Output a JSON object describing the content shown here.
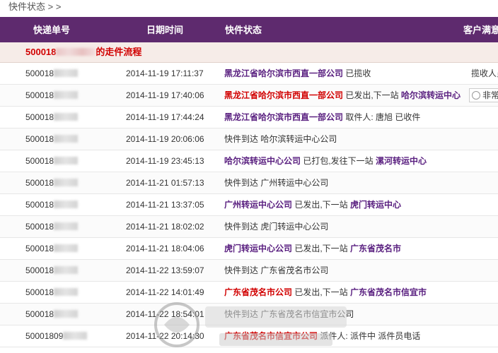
{
  "breadcrumb": "快件状态 > >",
  "columns": [
    "快递单号",
    "日期时间",
    "快件状态",
    "客户满意"
  ],
  "subheader": {
    "prefix": "500018",
    "suffix": "的走件流程"
  },
  "rows": [
    {
      "num": "500018",
      "time": "2014-11-19 17:11:37",
      "status": [
        {
          "t": "黑龙江省哈尔滨市西直一部公司",
          "s": "a1"
        },
        {
          "t": " 已揽收",
          "s": ""
        }
      ],
      "extra": "揽收人员"
    },
    {
      "num": "500018",
      "time": "2014-11-19 17:40:06",
      "status": [
        {
          "t": "黑龙江省哈尔滨市西直一部公司",
          "s": "a2"
        },
        {
          "t": " 已发出,下一站 ",
          "s": ""
        },
        {
          "t": "哈尔滨转运中心",
          "s": "a1"
        }
      ],
      "extra": "非常"
    },
    {
      "num": "500018",
      "time": "2014-11-19 17:44:24",
      "status": [
        {
          "t": "黑龙江省哈尔滨市西直一部公司",
          "s": "a1"
        },
        {
          "t": " 取件人: 唐旭 已收件",
          "s": ""
        }
      ],
      "extra": ""
    },
    {
      "num": "500018",
      "time": "2014-11-19 20:06:06",
      "status": [
        {
          "t": "快件到达 哈尔滨转运中心公司",
          "s": ""
        }
      ],
      "extra": ""
    },
    {
      "num": "500018",
      "time": "2014-11-19 23:45:13",
      "status": [
        {
          "t": "哈尔滨转运中心公司",
          "s": "a1"
        },
        {
          "t": " 已打包,发往下一站 ",
          "s": ""
        },
        {
          "t": "漯河转运中心",
          "s": "a1"
        }
      ],
      "extra": ""
    },
    {
      "num": "500018",
      "time": "2014-11-21 01:57:13",
      "status": [
        {
          "t": "快件到达 广州转运中心公司",
          "s": ""
        }
      ],
      "extra": ""
    },
    {
      "num": "500018",
      "time": "2014-11-21 13:37:05",
      "status": [
        {
          "t": "广州转运中心公司",
          "s": "a1"
        },
        {
          "t": " 已发出,下一站 ",
          "s": ""
        },
        {
          "t": "虎门转运中心",
          "s": "a1"
        }
      ],
      "extra": ""
    },
    {
      "num": "500018",
      "time": "2014-11-21 18:02:02",
      "status": [
        {
          "t": "快件到达 虎门转运中心公司",
          "s": ""
        }
      ],
      "extra": ""
    },
    {
      "num": "500018",
      "time": "2014-11-21 18:04:06",
      "status": [
        {
          "t": "虎门转运中心公司",
          "s": "a1"
        },
        {
          "t": " 已发出,下一站 ",
          "s": ""
        },
        {
          "t": "广东省茂名市",
          "s": "a1"
        }
      ],
      "extra": ""
    },
    {
      "num": "500018",
      "time": "2014-11-22 13:59:07",
      "status": [
        {
          "t": "快件到达 广东省茂名市公司",
          "s": ""
        }
      ],
      "extra": ""
    },
    {
      "num": "500018",
      "time": "2014-11-22 14:01:49",
      "status": [
        {
          "t": "广东省茂名市公司",
          "s": "a2"
        },
        {
          "t": " 已发出,下一站 ",
          "s": ""
        },
        {
          "t": "广东省茂名市信宜市",
          "s": "a1"
        }
      ],
      "extra": ""
    },
    {
      "num": "500018",
      "time": "2014-11-22 18:54:01",
      "status": [
        {
          "t": "快件到达 广东省茂名市信宜市公司",
          "s": ""
        }
      ],
      "extra": ""
    },
    {
      "num": "50001809",
      "time": "2014-11-22 20:14:30",
      "status": [
        {
          "t": "广东省茂名市信宜市公司",
          "s": "a2"
        },
        {
          "t": " 派件人: ",
          "s": ""
        },
        {
          "t": "     ",
          "s": "blank"
        },
        {
          "t": " 派件中 派件员电话",
          "s": ""
        }
      ],
      "extra": ""
    }
  ],
  "colors": {
    "header_bg": "#5e2a6e",
    "accent_red": "#d10000",
    "accent_purple": "#5a2080"
  },
  "watermark": "www.06681.com"
}
